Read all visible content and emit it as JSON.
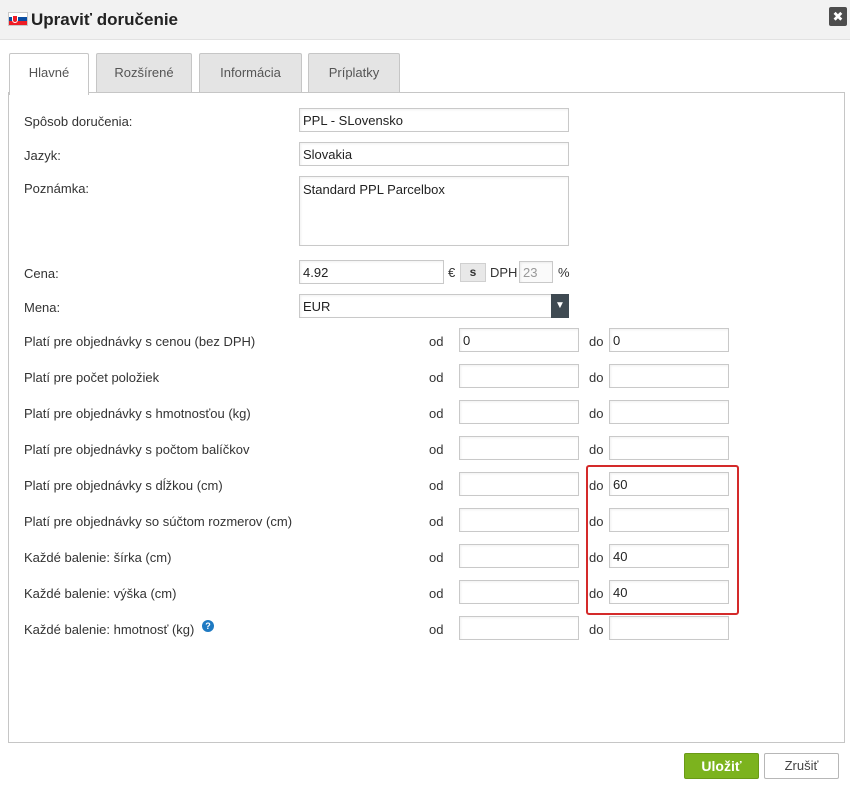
{
  "dialog": {
    "title": "Upraviť doručenie",
    "flag_icon": "slovakia-flag-icon",
    "close_label": "✖"
  },
  "tabs": [
    {
      "label": "Hlavné",
      "active": true
    },
    {
      "label": "Rozšírené",
      "active": false
    },
    {
      "label": "Informácia",
      "active": false
    },
    {
      "label": "Príplatky",
      "active": false
    }
  ],
  "form": {
    "sposob": {
      "label": "Spôsob doručenia:",
      "value": "PPL - SLovensko"
    },
    "jazyk": {
      "label": "Jazyk:",
      "value": "Slovakia"
    },
    "poznamka": {
      "label": "Poznámka:",
      "value": "Standard PPL Parcelbox"
    },
    "cena": {
      "label": "Cena:",
      "value": "4.92",
      "currency_symbol": "€",
      "vat_toggle": "s",
      "vat_label": "DPH",
      "vat_value": "23",
      "percent": "%"
    },
    "mena": {
      "label": "Mena:",
      "value": "EUR"
    },
    "od_label": "od",
    "do_label": "do",
    "ranges": [
      {
        "label": "Platí pre objednávky s cenou (bez DPH)",
        "od": "0",
        "do": "0"
      },
      {
        "label": "Platí pre počet položiek",
        "od": "",
        "do": ""
      },
      {
        "label": "Platí pre objednávky s hmotnosťou (kg)",
        "od": "",
        "do": ""
      },
      {
        "label": "Platí pre objednávky s počtom balíčkov",
        "od": "",
        "do": ""
      },
      {
        "label": "Platí pre objednávky s dĺžkou (cm)",
        "od": "",
        "do": "60"
      },
      {
        "label": "Platí pre objednávky so súčtom rozmerov (cm)",
        "od": "",
        "do": ""
      },
      {
        "label": "Každé balenie: šírka (cm)",
        "od": "",
        "do": "40"
      },
      {
        "label": "Každé balenie: výška (cm)",
        "od": "",
        "do": "40"
      },
      {
        "label": "Každé balenie: hmotnosť (kg)",
        "od": "",
        "do": ""
      }
    ]
  },
  "footer": {
    "save_label": "Uložiť",
    "cancel_label": "Zrušiť"
  },
  "colors": {
    "save_green": "#7cb31e",
    "highlight_red": "#d42a2a",
    "help_blue": "#1f7ac2"
  }
}
